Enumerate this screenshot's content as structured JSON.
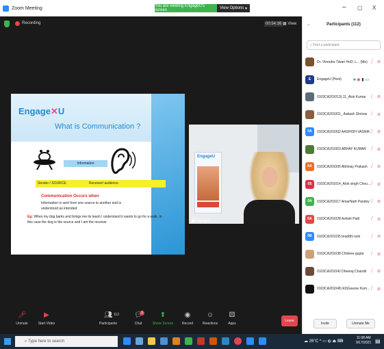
{
  "titlebar": {
    "app_title": "Zoom Meeting",
    "viewing_banner": "You are viewing EngageU's screen",
    "view_options": "View Options",
    "minimize": "–",
    "maximize": "▢",
    "close": "X"
  },
  "meeting": {
    "recording_label": "Recording",
    "timer": "00:54:36",
    "view_label": "View",
    "slide": {
      "logo_a": "Engage",
      "logo_x": "✕",
      "logo_b": "U",
      "title": "What is Communication ?",
      "info_label": "Information",
      "sender_label": "Sender / SOURCE",
      "receiver_label": "Receiver/ audience",
      "occurs_heading": "Communication Occurs when",
      "definition_1": "Information is sent from one source to another and is",
      "definition_2": "understood as intended",
      "example_tag": "Eg:",
      "example_text": "When my dog barks and brings me its leash I understand it wants to go for a walk. In this case the dog is the source and I am the receiver"
    },
    "video": {
      "banner_logo": "EngageU",
      "speaker_name": "EngageU"
    }
  },
  "toolbar": {
    "unmute": "Unmute",
    "start_video": "Start Video",
    "participants": "Participants",
    "participants_count": "112",
    "chat": "Chat",
    "chat_badge": "1",
    "share_screen": "Share Screen",
    "record": "Record",
    "reactions": "Reactions",
    "apps": "Apps",
    "leave": "Leave"
  },
  "panel": {
    "title": "Participants (112)",
    "search_placeholder": "Find a participant",
    "participants": [
      {
        "initials": "",
        "name": "Dr. Virendra Tiwari HoD; L... (Me)",
        "color": "#7a5230"
      },
      {
        "initials": "E",
        "name": "EngageU (Host)",
        "color": "#1f3c88"
      },
      {
        "initials": "",
        "name": "0103CA201013).11_Alok Kumar",
        "color": "#5c6b7a"
      },
      {
        "initials": "",
        "name": "0103CA201001_ Aakash Shrivas",
        "color": "#8b5e3c"
      },
      {
        "initials": "0A",
        "name": "0103CA201002 AASHISH VASNIK",
        "color": "#2d8cff"
      },
      {
        "initials": "",
        "name": "0103CA201003 ABHAY KUMAR",
        "color": "#4e7a3a"
      },
      {
        "initials": "0A",
        "name": "0103CA201005 Abhinay Prakash",
        "color": "#e8702a"
      },
      {
        "initials": "0S",
        "name": "0103CA201014_Alok singh Chou...",
        "color": "#d8324a"
      },
      {
        "initials": "0A",
        "name": "0103CA201017 AmarNath Pandey",
        "color": "#3fb34f"
      },
      {
        "initials": "0A",
        "name": "0103CA201028 Ashish Patil",
        "color": "#e0474c"
      },
      {
        "initials": "0B",
        "name": "0103CA201035 braddhi soni",
        "color": "#2d8cff"
      },
      {
        "initials": "",
        "name": "0103CA201038 Chinkee gupta",
        "color": "#c9a27a"
      },
      {
        "initials": "",
        "name": "0103CA201042 Dheeraj Chandil",
        "color": "#6b4a3a"
      },
      {
        "initials": "",
        "name": "0103CA201048 (43)Gaurav Kum...",
        "color": "#111111"
      }
    ],
    "invite": "Invite",
    "unmute_me": "Unmute Me"
  },
  "taskbar": {
    "search_placeholder": "Type here to search",
    "weather": "26°C",
    "time": "11:08 AM",
    "date": "9/17/2021"
  }
}
